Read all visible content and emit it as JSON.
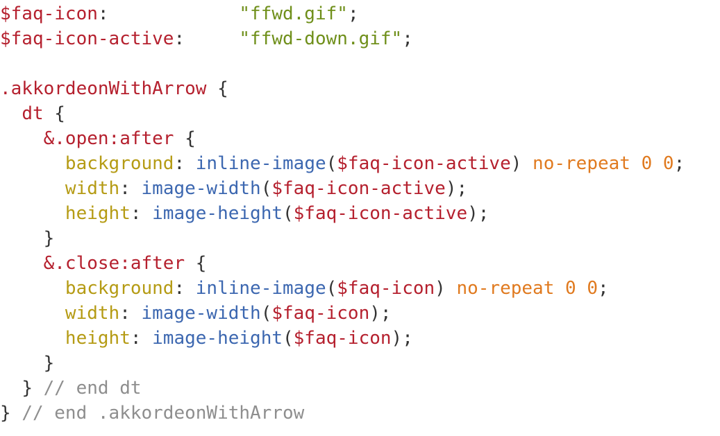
{
  "editor": {
    "lines": [
      [
        {
          "t": "$faq-icon",
          "c": "var"
        },
        {
          "t": ":",
          "c": "punc"
        },
        {
          "t": "            ",
          "c": "ws"
        },
        {
          "t": "\"ffwd.gif\"",
          "c": "str"
        },
        {
          "t": ";",
          "c": "punc"
        }
      ],
      [
        {
          "t": "$faq-icon-active",
          "c": "var"
        },
        {
          "t": ":",
          "c": "punc"
        },
        {
          "t": "     ",
          "c": "ws"
        },
        {
          "t": "\"ffwd-down.gif\"",
          "c": "str"
        },
        {
          "t": ";",
          "c": "punc"
        }
      ],
      [],
      [
        {
          "t": ".akkordeonWithArrow",
          "c": "sel"
        },
        {
          "t": " ",
          "c": "ws"
        },
        {
          "t": "{",
          "c": "punc"
        }
      ],
      [
        {
          "t": "  ",
          "c": "ws"
        },
        {
          "t": "dt",
          "c": "sel"
        },
        {
          "t": " ",
          "c": "ws"
        },
        {
          "t": "{",
          "c": "punc"
        }
      ],
      [
        {
          "t": "    ",
          "c": "ws"
        },
        {
          "t": "&.open:after",
          "c": "sel"
        },
        {
          "t": " ",
          "c": "ws"
        },
        {
          "t": "{",
          "c": "punc"
        }
      ],
      [
        {
          "t": "      ",
          "c": "ws"
        },
        {
          "t": "background",
          "c": "prop"
        },
        {
          "t": ": ",
          "c": "punc"
        },
        {
          "t": "inline-image",
          "c": "fn"
        },
        {
          "t": "(",
          "c": "punc"
        },
        {
          "t": "$faq-icon-active",
          "c": "var"
        },
        {
          "t": ")",
          "c": "punc"
        },
        {
          "t": " ",
          "c": "ws"
        },
        {
          "t": "no-repeat",
          "c": "val"
        },
        {
          "t": " ",
          "c": "ws"
        },
        {
          "t": "0",
          "c": "num"
        },
        {
          "t": " ",
          "c": "ws"
        },
        {
          "t": "0",
          "c": "num"
        },
        {
          "t": ";",
          "c": "punc"
        }
      ],
      [
        {
          "t": "      ",
          "c": "ws"
        },
        {
          "t": "width",
          "c": "prop"
        },
        {
          "t": ": ",
          "c": "punc"
        },
        {
          "t": "image-width",
          "c": "fn"
        },
        {
          "t": "(",
          "c": "punc"
        },
        {
          "t": "$faq-icon-active",
          "c": "var"
        },
        {
          "t": ");",
          "c": "punc"
        }
      ],
      [
        {
          "t": "      ",
          "c": "ws"
        },
        {
          "t": "height",
          "c": "prop"
        },
        {
          "t": ": ",
          "c": "punc"
        },
        {
          "t": "image-height",
          "c": "fn"
        },
        {
          "t": "(",
          "c": "punc"
        },
        {
          "t": "$faq-icon-active",
          "c": "var"
        },
        {
          "t": ");",
          "c": "punc"
        }
      ],
      [
        {
          "t": "    ",
          "c": "ws"
        },
        {
          "t": "}",
          "c": "punc"
        }
      ],
      [
        {
          "t": "    ",
          "c": "ws"
        },
        {
          "t": "&.close:after",
          "c": "sel"
        },
        {
          "t": " ",
          "c": "ws"
        },
        {
          "t": "{",
          "c": "punc"
        }
      ],
      [
        {
          "t": "      ",
          "c": "ws"
        },
        {
          "t": "background",
          "c": "prop"
        },
        {
          "t": ": ",
          "c": "punc"
        },
        {
          "t": "inline-image",
          "c": "fn"
        },
        {
          "t": "(",
          "c": "punc"
        },
        {
          "t": "$faq-icon",
          "c": "var"
        },
        {
          "t": ")",
          "c": "punc"
        },
        {
          "t": " ",
          "c": "ws"
        },
        {
          "t": "no-repeat",
          "c": "val"
        },
        {
          "t": " ",
          "c": "ws"
        },
        {
          "t": "0",
          "c": "num"
        },
        {
          "t": " ",
          "c": "ws"
        },
        {
          "t": "0",
          "c": "num"
        },
        {
          "t": ";",
          "c": "punc"
        }
      ],
      [
        {
          "t": "      ",
          "c": "ws"
        },
        {
          "t": "width",
          "c": "prop"
        },
        {
          "t": ": ",
          "c": "punc"
        },
        {
          "t": "image-width",
          "c": "fn"
        },
        {
          "t": "(",
          "c": "punc"
        },
        {
          "t": "$faq-icon",
          "c": "var"
        },
        {
          "t": ");",
          "c": "punc"
        }
      ],
      [
        {
          "t": "      ",
          "c": "ws"
        },
        {
          "t": "height",
          "c": "prop"
        },
        {
          "t": ": ",
          "c": "punc"
        },
        {
          "t": "image-height",
          "c": "fn"
        },
        {
          "t": "(",
          "c": "punc"
        },
        {
          "t": "$faq-icon",
          "c": "var"
        },
        {
          "t": ");",
          "c": "punc"
        }
      ],
      [
        {
          "t": "    ",
          "c": "ws"
        },
        {
          "t": "}",
          "c": "punc"
        }
      ],
      [
        {
          "t": "  ",
          "c": "ws"
        },
        {
          "t": "}",
          "c": "punc"
        },
        {
          "t": " ",
          "c": "ws"
        },
        {
          "t": "// end dt",
          "c": "comment"
        }
      ],
      [
        {
          "t": "}",
          "c": "punc"
        },
        {
          "t": " ",
          "c": "ws"
        },
        {
          "t": "// end .akkordeonWithArrow",
          "c": "comment"
        }
      ]
    ],
    "colors": {
      "variable": "#b5202e",
      "string": "#6f8f1a",
      "selector": "#b5202e",
      "property": "#b59b14",
      "function": "#3c67b0",
      "value": "#e07a1f",
      "number": "#e07a1f",
      "punctuation": "#333333",
      "comment": "#8e8e8e",
      "background": "#ffffff"
    }
  }
}
